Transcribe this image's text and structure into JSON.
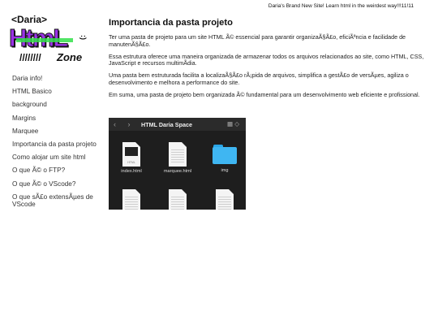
{
  "banner": {
    "text": "Daria's Brand New Site! Learn html in the weirdest way!!!11!11"
  },
  "logo": {
    "tag": "<Daria>",
    "word": "HtmL",
    "smile": ":)",
    "slashes": "////////",
    "zone": "Zone"
  },
  "sidebar": {
    "items": [
      {
        "label": "Daria info!"
      },
      {
        "label": "HTML Basico"
      },
      {
        "label": "background"
      },
      {
        "label": "Margins"
      },
      {
        "label": "Marquee"
      },
      {
        "label": "Importancia da pasta projeto"
      },
      {
        "label": "Como alojar um site html"
      },
      {
        "label": "O que Ã© o FTP?"
      },
      {
        "label": "O que Ã© o VScode?"
      },
      {
        "label": "O que sÃ£o extensÃµes de VScode"
      }
    ]
  },
  "main": {
    "title": "Importancia da pasta projeto",
    "paragraphs": [
      "Ter uma pasta de projeto para um site HTML Ã© essencial para garantir organizaÃ§Ã£o, eficiÃªncia e facilidade de manutenÃ§Ã£o.",
      "Essa estrutura oferece uma maneira organizada de armazenar todos os arquivos relacionados ao site, como HTML, CSS, JavaScript e recursos multimÃdia.",
      "Uma pasta bem estruturada facilita a localizaÃ§Ã£o rÃ¡pida de arquivos, simplifica a gestÃ£o de versÃµes, agiliza o desenvolvimento e melhora a performance do site.",
      "Em suma, uma pasta de projeto bem organizada Ã© fundamental para um desenvolvimento web eficiente e profissional."
    ]
  },
  "finder": {
    "nav": "‹ ›",
    "title": "HTML Daria Space",
    "view_icon": "▦ ◇",
    "files": [
      {
        "name": "index.html",
        "kind": "html-doc"
      },
      {
        "name": "marquee.html",
        "kind": "doc"
      },
      {
        "name": "img",
        "kind": "folder"
      },
      {
        "name": "",
        "kind": "doc"
      },
      {
        "name": "",
        "kind": "doc"
      },
      {
        "name": "",
        "kind": "doc"
      }
    ],
    "doc_badge": "HTML",
    "folder_color": "#3fb6f2"
  }
}
